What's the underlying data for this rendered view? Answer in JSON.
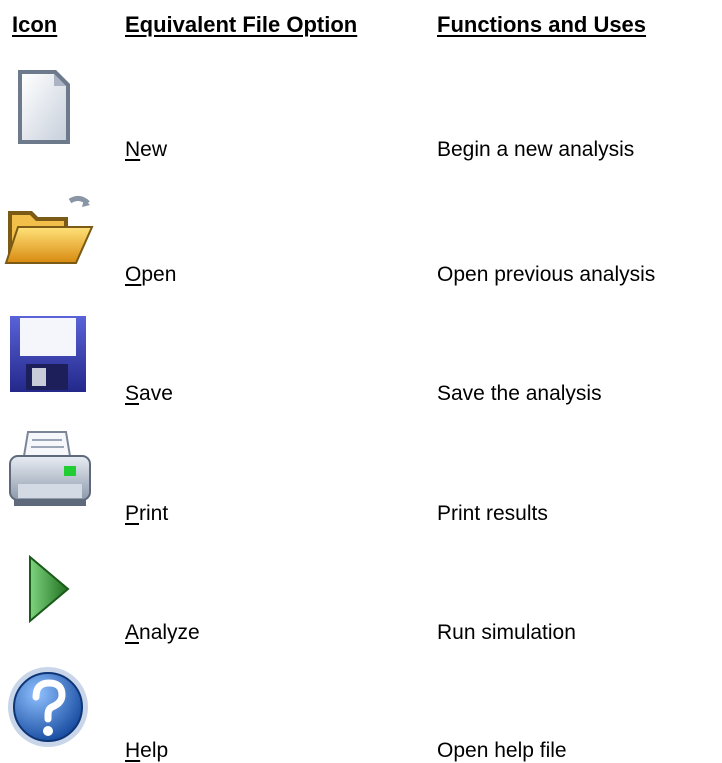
{
  "headers": {
    "icon": "Icon",
    "option": "Equivalent File Option",
    "functions": "Functions and Uses"
  },
  "rows": [
    {
      "icon": "new-document-icon",
      "accel": "N",
      "rest": "ew",
      "function": "Begin a new analysis"
    },
    {
      "icon": "open-folder-icon",
      "accel": "O",
      "rest": "pen",
      "function": "Open previous analysis"
    },
    {
      "icon": "floppy-disk-icon",
      "accel": "S",
      "rest": "ave",
      "function": "Save the analysis"
    },
    {
      "icon": "printer-icon",
      "accel": "P",
      "rest": "rint",
      "function": "Print results"
    },
    {
      "icon": "play-arrow-icon",
      "accel": "A",
      "rest": "nalyze",
      "function": "Run simulation"
    },
    {
      "icon": "help-icon",
      "accel": "H",
      "rest": "elp",
      "function": "Open help file"
    }
  ],
  "colors": {
    "folder": "#f2b42b",
    "floppy": "#3a3fb8",
    "play": "#2e8b2e",
    "help": "#1f5fbf"
  }
}
